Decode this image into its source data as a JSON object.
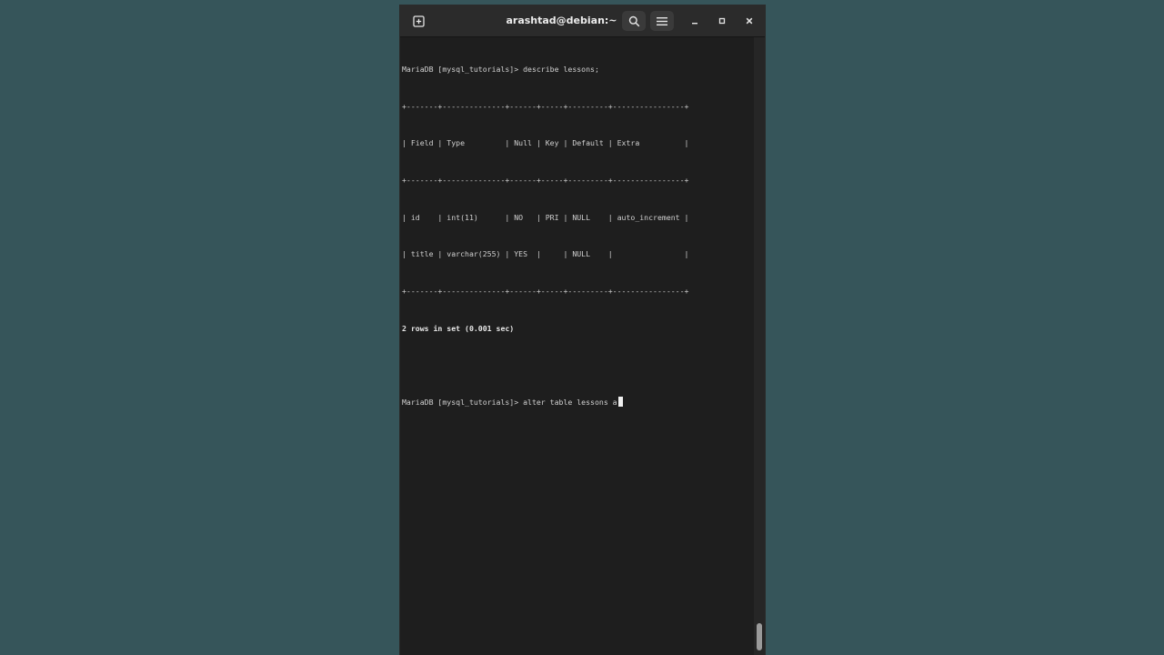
{
  "window": {
    "title": "arashtad@debian:~"
  },
  "titlebar": {
    "icons": [
      "new-tab-icon",
      "search-icon",
      "hamburger-menu-icon",
      "minimize-icon",
      "maximize-icon",
      "close-icon"
    ]
  },
  "terminal": {
    "prompt": "MariaDB [mysql_tutorials]> ",
    "command1": "describe lessons;",
    "table_lines": [
      "+-------+--------------+------+-----+---------+----------------+",
      "| Field | Type         | Null | Key | Default | Extra          |",
      "+-------+--------------+------+-----+---------+----------------+",
      "| id    | int(11)      | NO   | PRI | NULL    | auto_increment |",
      "| title | varchar(255) | YES  |     | NULL    |                |",
      "+-------+--------------+------+-----+---------+----------------+"
    ],
    "result_summary": "2 rows in set (0.001 sec)",
    "current_input": "alter table lessons a"
  }
}
